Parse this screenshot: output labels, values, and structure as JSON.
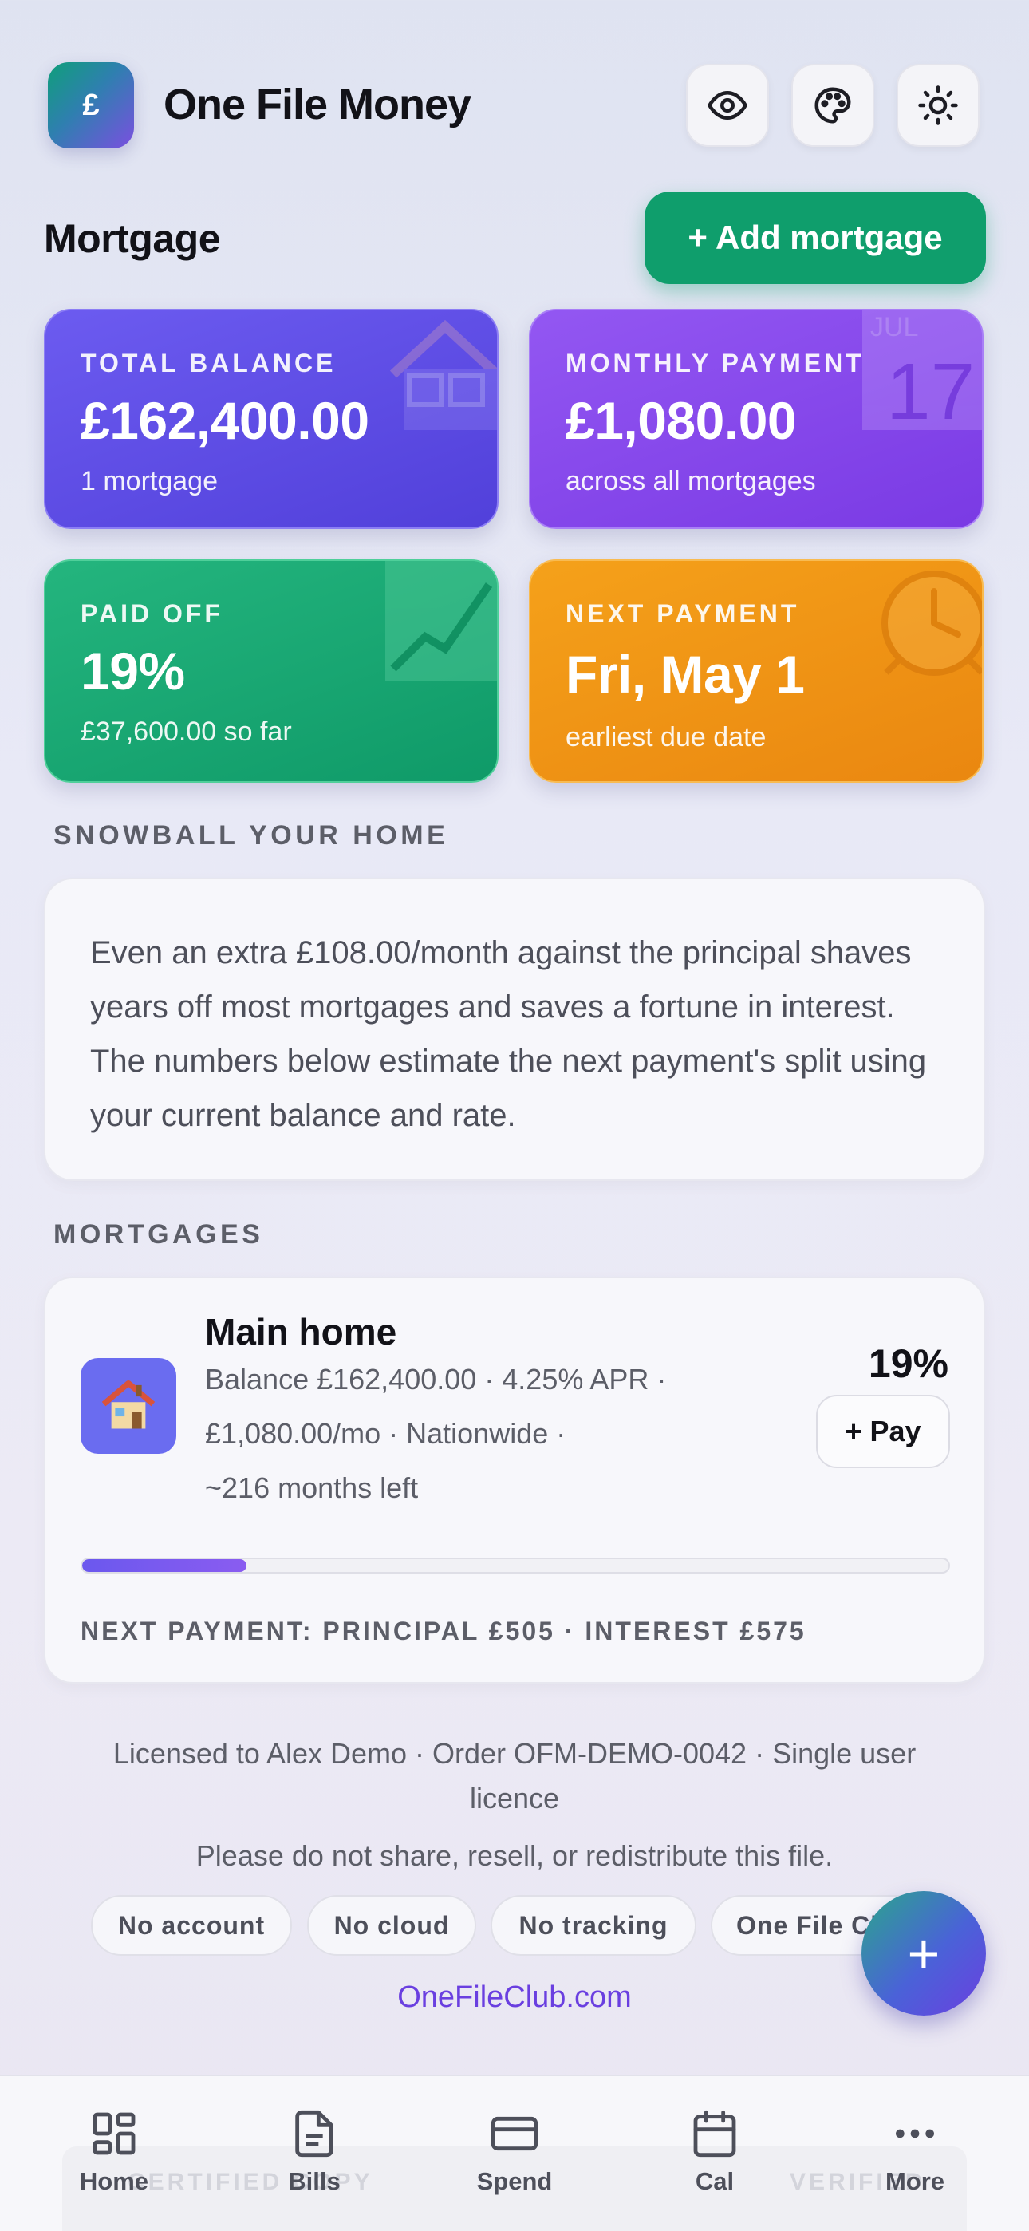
{
  "header": {
    "logo_glyph": "£",
    "title": "One File Money",
    "buttons": [
      "eye-icon",
      "palette-icon",
      "sun-icon"
    ]
  },
  "page": {
    "section_title": "Mortgage",
    "add_button": "+ Add mortgage"
  },
  "stats": {
    "balance": {
      "label": "TOTAL BALANCE",
      "value": "£162,400.00",
      "sub": "1 mortgage",
      "icon": "house-icon"
    },
    "monthly": {
      "label": "MONTHLY PAYMENT",
      "value": "£1,080.00",
      "sub": "across all mortgages",
      "icon": "calendar-icon",
      "icon_month": "JUL",
      "icon_day": "17"
    },
    "paid": {
      "label": "PAID OFF",
      "value": "19%",
      "sub": "£37,600.00 so far",
      "icon": "trend-chart-icon"
    },
    "next": {
      "label": "NEXT PAYMENT",
      "value": "Fri, May 1",
      "sub": "earliest due date",
      "icon": "alarm-clock-icon"
    }
  },
  "snowball": {
    "heading": "SNOWBALL YOUR HOME",
    "body": "Even an extra £108.00/month against the principal shaves years off most mortgages and saves a fortune in interest. The numbers below estimate the next payment's split using your current balance and rate."
  },
  "mortgages": {
    "heading": "MORTGAGES",
    "items": [
      {
        "icon": "house-emoji-icon",
        "name": "Main home",
        "line1": "Balance £162,400.00  ·  4.25% APR  ·",
        "line2": "£1,080.00/mo  ·  Nationwide  ·",
        "line3": "~216 months left",
        "percent": "19%",
        "progress": 0.19,
        "pay_button": "+ Pay",
        "next_split": "NEXT PAYMENT: PRINCIPAL £505   ·   INTEREST £575"
      }
    ]
  },
  "footer": {
    "license": "Licensed to Alex Demo · Order OFM-DEMO-0042 · Single user licence",
    "notice": "Please do not share, resell, or redistribute this file.",
    "pills": [
      "No account",
      "No cloud",
      "No tracking",
      "One File Club"
    ],
    "link": "OneFileClub.com"
  },
  "fab": {
    "label": "+"
  },
  "watermark": {
    "left": "CERTIFIED COPY",
    "right": "VERIFIED"
  },
  "nav": [
    {
      "label": "Home",
      "icon": "grid-icon"
    },
    {
      "label": "Bills",
      "icon": "document-icon"
    },
    {
      "label": "Spend",
      "icon": "credit-card-icon"
    },
    {
      "label": "Cal",
      "icon": "calendar-icon"
    },
    {
      "label": "More",
      "icon": "more-dots-icon"
    }
  ],
  "colors": {
    "accent_green": "#0f9e6c",
    "balance_card": "#5b4ae6",
    "monthly_card": "#8447ec",
    "paid_card": "#14a673",
    "next_card": "#f0951a",
    "progress": "#6b58ee",
    "link": "#6a3fe0"
  }
}
